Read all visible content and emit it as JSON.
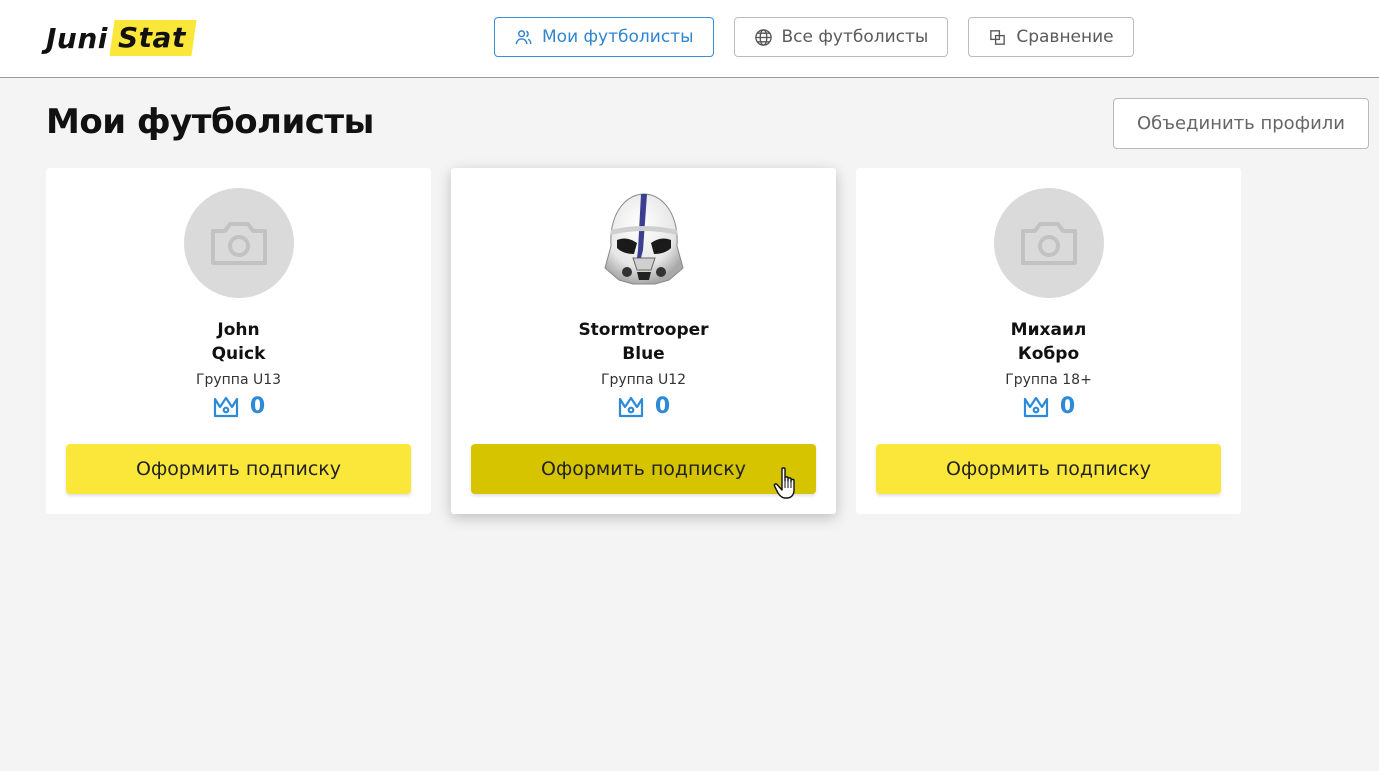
{
  "logo": {
    "part1": "Juni",
    "part2": "Stat"
  },
  "nav": {
    "items": [
      {
        "label": "Мои футболисты",
        "icon": "users-icon",
        "active": true
      },
      {
        "label": "Все футболисты",
        "icon": "globe-icon",
        "active": false
      },
      {
        "label": "Сравнение",
        "icon": "compare-icon",
        "active": false
      }
    ]
  },
  "page": {
    "title": "Мои футболисты",
    "merge_label": "Объединить профили"
  },
  "players": [
    {
      "first_name": "John",
      "last_name": "Quick",
      "group": "Группа U13",
      "score": "0",
      "subscribe_label": "Оформить подписку",
      "avatar": "camera-placeholder"
    },
    {
      "first_name": "Stormtrooper",
      "last_name": "Blue",
      "group": "Группа U12",
      "score": "0",
      "subscribe_label": "Оформить подписку",
      "avatar": "stormtrooper-helmet"
    },
    {
      "first_name": "Михаил",
      "last_name": "Кобро",
      "group": "Группа 18+",
      "score": "0",
      "subscribe_label": "Оформить подписку",
      "avatar": "camera-placeholder"
    }
  ],
  "colors": {
    "accent_blue": "#2d8ad6",
    "brand_yellow": "#fbe73a",
    "button_hover": "#d6c400"
  }
}
